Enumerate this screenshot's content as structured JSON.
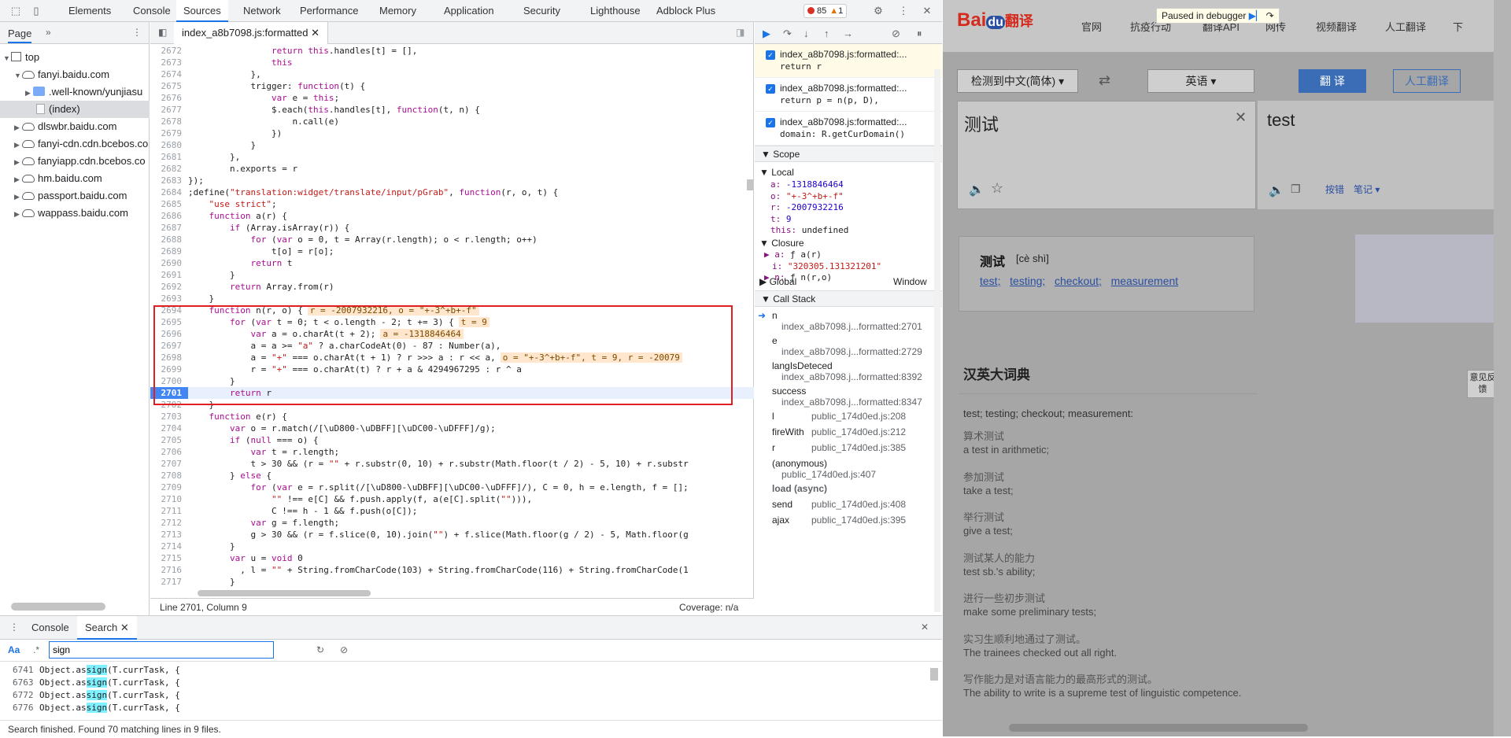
{
  "devtools": {
    "tabs": [
      "Elements",
      "Console",
      "Sources",
      "Network",
      "Performance",
      "Memory",
      "Application",
      "Security",
      "Lighthouse",
      "Adblock Plus"
    ],
    "active_tab": "Sources",
    "errors": "85",
    "warnings": "1",
    "navigator": {
      "tab": "Page",
      "items": [
        "top",
        "fanyi.baidu.com",
        ".well-known/yunjiasu",
        "(index)",
        "dlswbr.baidu.com",
        "fanyi-cdn.cdn.bcebos.co",
        "fanyiapp.cdn.bcebos.co",
        "hm.baidu.com",
        "passport.baidu.com",
        "wappass.baidu.com"
      ]
    },
    "editor": {
      "file_tab": "index_a8b7098.js:formatted",
      "status_left": "Line 2701, Column 9",
      "status_right": "Coverage: n/a",
      "lines": [
        {
          "n": "2672",
          "t": "                return this.handles[t] = [],"
        },
        {
          "n": "2673",
          "t": "                this"
        },
        {
          "n": "2674",
          "t": "            },"
        },
        {
          "n": "2675",
          "t": "            trigger: function(t) {"
        },
        {
          "n": "2676",
          "t": "                var e = this;"
        },
        {
          "n": "2677",
          "t": "                $.each(this.handles[t], function(t, n) {"
        },
        {
          "n": "2678",
          "t": "                    n.call(e)"
        },
        {
          "n": "2679",
          "t": "                })"
        },
        {
          "n": "2680",
          "t": "            }"
        },
        {
          "n": "2681",
          "t": "        },"
        },
        {
          "n": "2682",
          "t": "        n.exports = r"
        },
        {
          "n": "2683",
          "t": "});"
        },
        {
          "n": "2684",
          "t": ";define(\"translation:widget/translate/input/pGrab\", function(r, o, t) {"
        },
        {
          "n": "2685",
          "t": "    \"use strict\";"
        },
        {
          "n": "2686",
          "t": "    function a(r) {"
        },
        {
          "n": "2687",
          "t": "        if (Array.isArray(r)) {"
        },
        {
          "n": "2688",
          "t": "            for (var o = 0, t = Array(r.length); o < r.length; o++)"
        },
        {
          "n": "2689",
          "t": "                t[o] = r[o];"
        },
        {
          "n": "2690",
          "t": "            return t"
        },
        {
          "n": "2691",
          "t": "        }"
        },
        {
          "n": "2692",
          "t": "        return Array.from(r)"
        },
        {
          "n": "2693",
          "t": "    }"
        },
        {
          "n": "2694",
          "t": "    function n(r, o) {",
          "i": "r = -2007932216, o = \"+-3^+b+-f\""
        },
        {
          "n": "2695",
          "t": "        for (var t = 0; t < o.length - 2; t += 3) {",
          "i": "t = 9"
        },
        {
          "n": "2696",
          "t": "            var a = o.charAt(t + 2);",
          "i": "a = -1318846464"
        },
        {
          "n": "2697",
          "t": "            a = a >= \"a\" ? a.charCodeAt(0) - 87 : Number(a),"
        },
        {
          "n": "2698",
          "t": "            a = \"+\" === o.charAt(t + 1) ? r >>> a : r << a,",
          "i": "o = \"+-3^+b+-f\", t = 9, r = -20079"
        },
        {
          "n": "2699",
          "t": "            r = \"+\" === o.charAt(t) ? r + a & 4294967295 : r ^ a"
        },
        {
          "n": "2700",
          "t": "        }"
        },
        {
          "n": "2701",
          "t": "        return r",
          "cur": true
        },
        {
          "n": "2702",
          "t": "    }"
        },
        {
          "n": "2703",
          "t": "    function e(r) {"
        },
        {
          "n": "2704",
          "t": "        var o = r.match(/[\\uD800-\\uDBFF][\\uDC00-\\uDFFF]/g);"
        },
        {
          "n": "2705",
          "t": "        if (null === o) {"
        },
        {
          "n": "2706",
          "t": "            var t = r.length;"
        },
        {
          "n": "2707",
          "t": "            t > 30 && (r = \"\" + r.substr(0, 10) + r.substr(Math.floor(t / 2) - 5, 10) + r.substr"
        },
        {
          "n": "2708",
          "t": "        } else {"
        },
        {
          "n": "2709",
          "t": "            for (var e = r.split(/[\\uD800-\\uDBFF][\\uDC00-\\uDFFF]/), C = 0, h = e.length, f = [];"
        },
        {
          "n": "2710",
          "t": "                \"\" !== e[C] && f.push.apply(f, a(e[C].split(\"\"))),"
        },
        {
          "n": "2711",
          "t": "                C !== h - 1 && f.push(o[C]);"
        },
        {
          "n": "2712",
          "t": "            var g = f.length;"
        },
        {
          "n": "2713",
          "t": "            g > 30 && (r = f.slice(0, 10).join(\"\") + f.slice(Math.floor(g / 2) - 5, Math.floor(g"
        },
        {
          "n": "2714",
          "t": "        }"
        },
        {
          "n": "2715",
          "t": "        var u = void 0"
        },
        {
          "n": "2716",
          "t": "          , l = \"\" + String.fromCharCode(103) + String.fromCharCode(116) + String.fromCharCode(1"
        },
        {
          "n": "2717",
          "t": "        }"
        }
      ]
    },
    "breakpoints": [
      {
        "file": "index_a8b7098.js:formatted:...",
        "code": "return r"
      },
      {
        "file": "index_a8b7098.js:formatted:...",
        "code": "return p = n(p, D),"
      },
      {
        "file": "index_a8b7098.js:formatted:...",
        "code": "domain: R.getCurDomain()"
      }
    ],
    "scope": {
      "title": "Scope",
      "local_title": "Local",
      "local": [
        {
          "k": "a:",
          "v": "-1318846464",
          "type": "n"
        },
        {
          "k": "o:",
          "v": "\"+-3^+b+-f\"",
          "type": "s"
        },
        {
          "k": "r:",
          "v": "-2007932216",
          "type": "n"
        },
        {
          "k": "t:",
          "v": "9",
          "type": "n"
        },
        {
          "k": "this:",
          "v": "undefined",
          "type": "u"
        }
      ],
      "closure_title": "Closure",
      "closure": [
        {
          "k": "a:",
          "v": "ƒ a(r)"
        },
        {
          "k": "i:",
          "v": "\"320305.131321201\""
        },
        {
          "k": "n:",
          "v": "ƒ n(r,o)"
        }
      ],
      "global": "Global",
      "global_val": "Window"
    },
    "callstack": {
      "title": "Call Stack",
      "frames": [
        {
          "fn": "n",
          "loc": "index_a8b7098.j...formatted:2701"
        },
        {
          "fn": "e",
          "loc": "index_a8b7098.j...formatted:2729"
        },
        {
          "fn": "langIsDeteced",
          "loc": "index_a8b7098.j...formatted:8392"
        },
        {
          "fn": "success",
          "loc": "index_a8b7098.j...formatted:8347"
        },
        {
          "fn": "l",
          "loc": "public_174d0ed.js:208"
        },
        {
          "fn": "fireWith",
          "loc": "public_174d0ed.js:212"
        },
        {
          "fn": "r",
          "loc": "public_174d0ed.js:385"
        },
        {
          "fn": "(anonymous)",
          "loc": "public_174d0ed.js:407"
        }
      ],
      "async": "load (async)",
      "frames2": [
        {
          "fn": "send",
          "loc": "public_174d0ed.js:408"
        },
        {
          "fn": "ajax",
          "loc": "public_174d0ed.js:395"
        }
      ]
    },
    "drawer": {
      "tabs": [
        "Console",
        "Search"
      ],
      "search_value": "sign",
      "case_label": "Aa",
      "regex_label": ".*",
      "results": [
        {
          "n": "6741",
          "pre": "Object.as",
          "hit": "sign",
          "post": "(T.currTask, {"
        },
        {
          "n": "6763",
          "pre": "Object.as",
          "hit": "sign",
          "post": "(T.currTask, {"
        },
        {
          "n": "6772",
          "pre": "Object.as",
          "hit": "sign",
          "post": "(T.currTask, {"
        },
        {
          "n": "6776",
          "pre": "Object.as",
          "hit": "sign",
          "post": "(T.currTask, {"
        }
      ],
      "status": "Search finished.  Found 70 matching lines in 9 files."
    }
  },
  "baidu": {
    "logo_a": "Bai",
    "logo_b": "du",
    "logo_c": "翻译",
    "nav": [
      "官网",
      "抗疫行动",
      "翻译API",
      "网传",
      "视频翻译",
      "人工翻译",
      "下"
    ],
    "paused": "Paused in debugger",
    "from_lang": "检测到中文(简体)",
    "to_lang": "英语",
    "translate_btn": "翻 译",
    "human_btn": "人工翻译",
    "input_text": "测试",
    "output_text": "test",
    "bookmark": "按错",
    "notes": "笔记",
    "word": "测试",
    "pinyin": "[cè shì]",
    "meanings": [
      "test;",
      "testing;",
      "checkout;",
      "measurement"
    ],
    "dict_title": "汉英大词典",
    "feedback": "意见反馈",
    "dict_summary": "test; testing; checkout; measurement:",
    "examples": [
      {
        "cn": "算术测试",
        "en": "a test in arithmetic;"
      },
      {
        "cn": "参加测试",
        "en": "take a test;"
      },
      {
        "cn": "举行测试",
        "en": "give a test;"
      },
      {
        "cn": "测试某人的能力",
        "en": "test sb.'s ability;"
      },
      {
        "cn": "进行一些初步测试",
        "en": "make some preliminary tests;"
      },
      {
        "cn": "实习生顺利地通过了测试。",
        "en": "The trainees checked out all right."
      },
      {
        "cn": "写作能力是对语言能力的最高形式的测试。",
        "en": "The ability to write is a supreme test of linguistic competence."
      }
    ]
  }
}
